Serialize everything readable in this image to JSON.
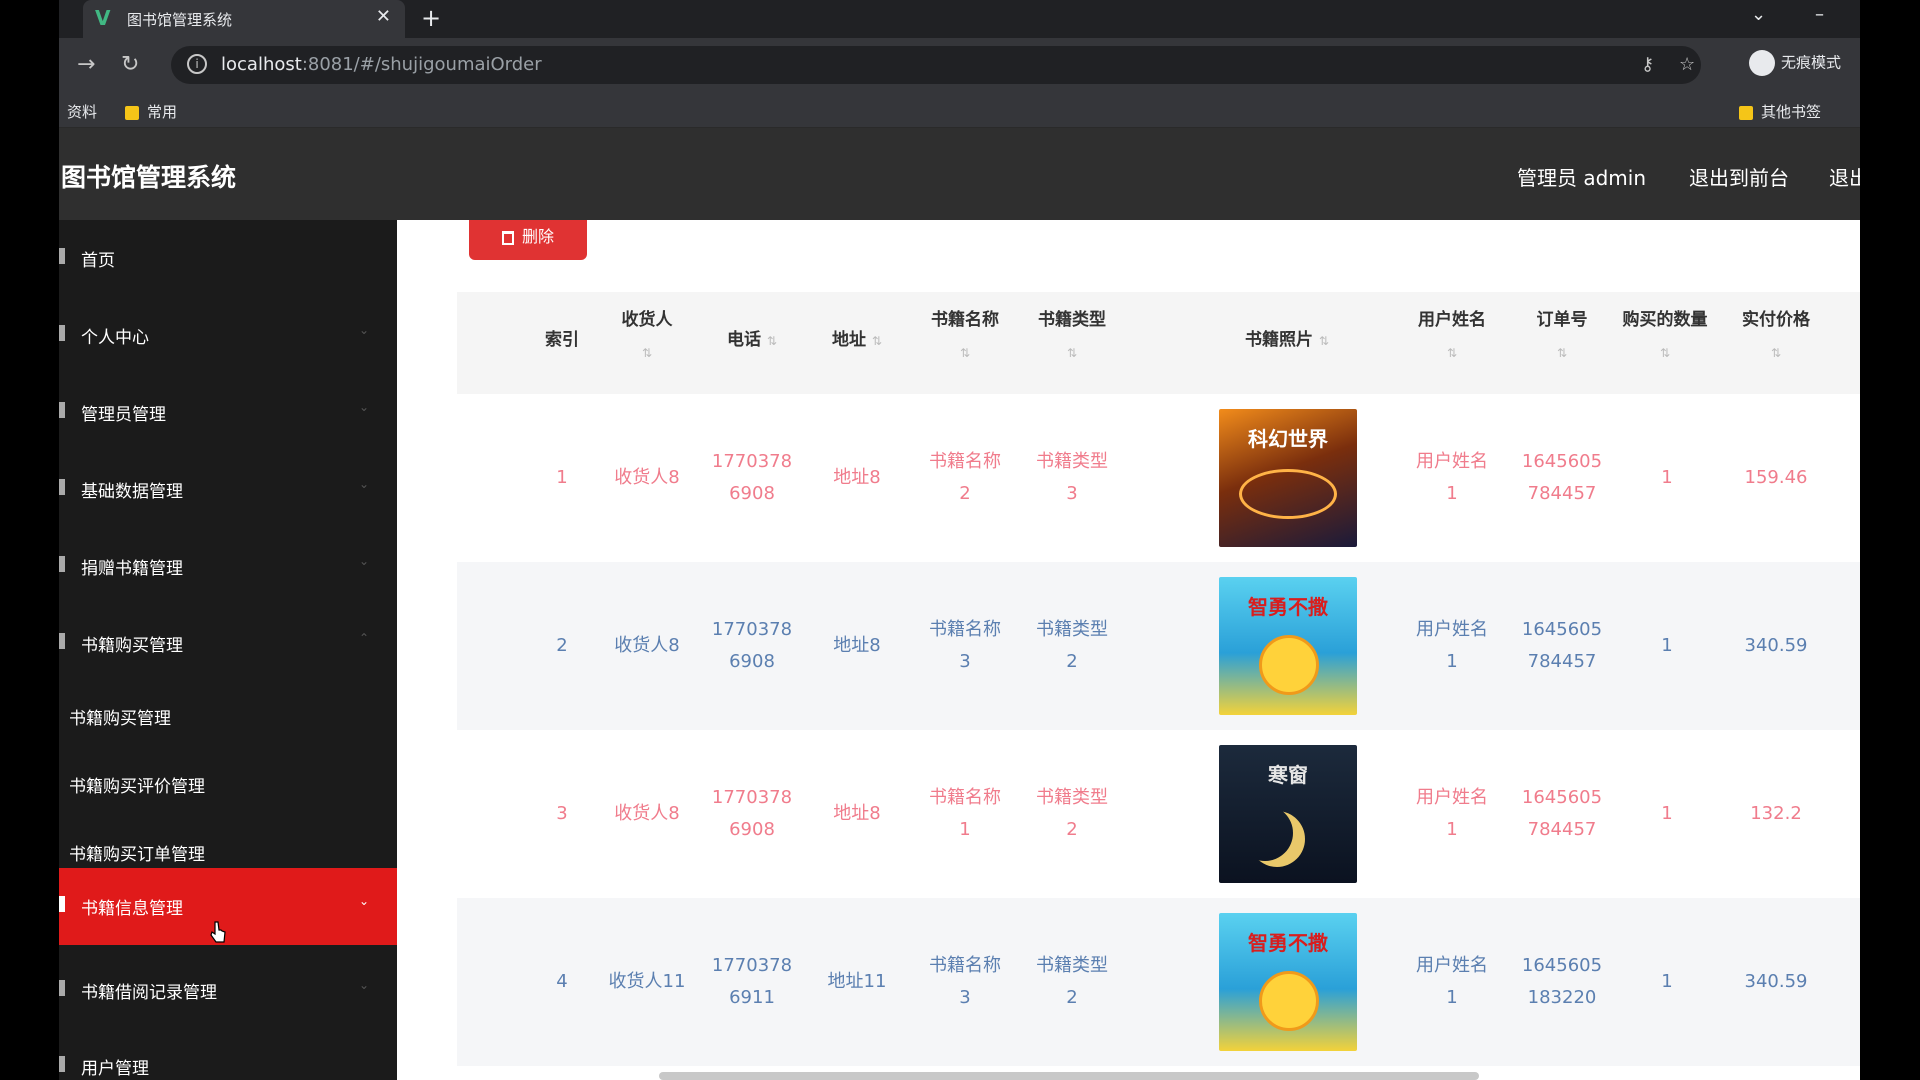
{
  "browser": {
    "tab_title": "图书馆管理系统",
    "url_host": "localhost",
    "url_path": ":8081/#/shujigoumaiOrder",
    "profile_label": "无痕模式",
    "bookmarks": {
      "item1": "资料",
      "item2": "常用",
      "other": "其他书签"
    }
  },
  "header": {
    "app_title": "图书馆管理系统",
    "admin": "管理员 admin",
    "exit_front": "退出到前台",
    "logout": "退出"
  },
  "sidebar": {
    "items": [
      {
        "label": "首页"
      },
      {
        "label": "个人中心"
      },
      {
        "label": "管理员管理"
      },
      {
        "label": "基础数据管理"
      },
      {
        "label": "捐赠书籍管理"
      },
      {
        "label": "书籍购买管理"
      }
    ],
    "sub_items": [
      {
        "label": "书籍购买管理"
      },
      {
        "label": "书籍购买评价管理"
      },
      {
        "label": "书籍购买订单管理"
      }
    ],
    "active": {
      "label": "书籍信息管理"
    },
    "after": [
      {
        "label": "书籍借阅记录管理"
      },
      {
        "label": "用户管理"
      }
    ]
  },
  "toolbar": {
    "delete_label": "删除"
  },
  "table": {
    "headers": {
      "index": "索引",
      "receiver": "收货人",
      "phone": "电话",
      "address": "地址",
      "book_name": "书籍名称",
      "book_type": "书籍类型",
      "book_photo": "书籍照片",
      "user_name": "用户姓名",
      "order_no": "订单号",
      "quantity": "购买的数量",
      "price": "实付价格"
    },
    "rows": [
      {
        "index": "1",
        "receiver": "收货人8",
        "phone": "17703786908",
        "address": "地址8",
        "book_name": "书籍名称2",
        "book_type": "书籍类型3",
        "photo_title": "科幻世界",
        "user_name": "用户姓名1",
        "order_no": "1645605784457",
        "quantity": "1",
        "price": "159.46",
        "color": "pink"
      },
      {
        "index": "2",
        "receiver": "收货人8",
        "phone": "17703786908",
        "address": "地址8",
        "book_name": "书籍名称3",
        "book_type": "书籍类型2",
        "photo_title": "智勇不撒",
        "user_name": "用户姓名1",
        "order_no": "1645605784457",
        "quantity": "1",
        "price": "340.59",
        "color": "blue"
      },
      {
        "index": "3",
        "receiver": "收货人8",
        "phone": "17703786908",
        "address": "地址8",
        "book_name": "书籍名称1",
        "book_type": "书籍类型2",
        "photo_title": "寒窗",
        "user_name": "用户姓名1",
        "order_no": "1645605784457",
        "quantity": "1",
        "price": "132.2",
        "color": "pink"
      },
      {
        "index": "4",
        "receiver": "收货人11",
        "phone": "17703786911",
        "address": "地址11",
        "book_name": "书籍名称3",
        "book_type": "书籍类型2",
        "photo_title": "智勇不撒",
        "user_name": "用户姓名1",
        "order_no": "1645605183220",
        "quantity": "1",
        "price": "340.59",
        "color": "blue"
      }
    ]
  }
}
